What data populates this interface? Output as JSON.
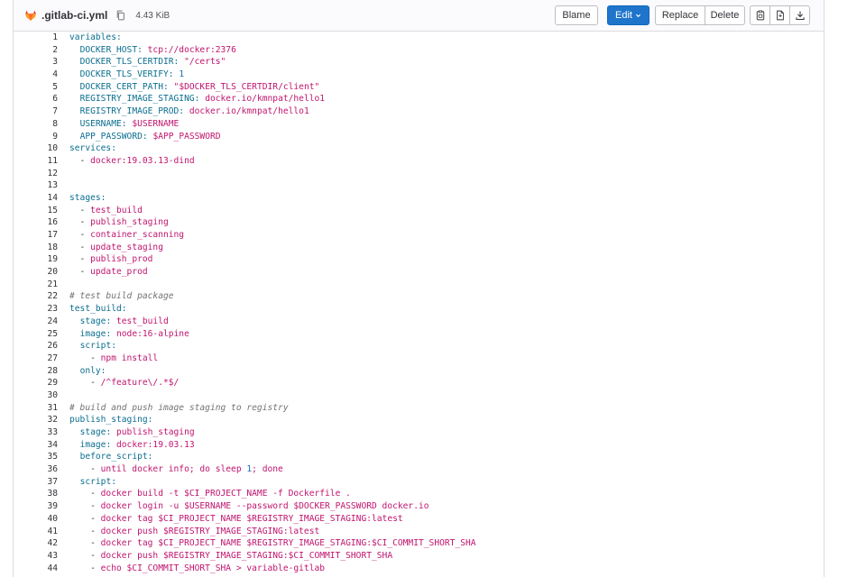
{
  "file": {
    "name": ".gitlab-ci.yml",
    "size": "4.43 KiB"
  },
  "toolbar": {
    "blame": "Blame",
    "edit": "Edit",
    "replace": "Replace",
    "delete": "Delete"
  },
  "icons": {
    "logo": "gitlab-logo-icon",
    "copy_path": "copy-icon",
    "copy_contents": "copy-contents-icon",
    "raw": "raw-file-icon",
    "download": "download-icon"
  },
  "colors": {
    "accent": "#1f75cb",
    "key": "#0b6e8f",
    "string": "#c0156e",
    "comment": "#737278"
  },
  "lines": [
    [
      [
        "k",
        "variables:"
      ]
    ],
    [
      [
        "p",
        "  "
      ],
      [
        "k",
        "DOCKER_HOST:"
      ],
      [
        "p",
        " "
      ],
      [
        "s",
        "tcp://docker:2376"
      ]
    ],
    [
      [
        "p",
        "  "
      ],
      [
        "k",
        "DOCKER_TLS_CERTDIR:"
      ],
      [
        "p",
        " "
      ],
      [
        "s",
        "\"/certs\""
      ]
    ],
    [
      [
        "p",
        "  "
      ],
      [
        "k",
        "DOCKER_TLS_VERIFY:"
      ],
      [
        "p",
        " "
      ],
      [
        "n",
        "1"
      ]
    ],
    [
      [
        "p",
        "  "
      ],
      [
        "k",
        "DOCKER_CERT_PATH:"
      ],
      [
        "p",
        " "
      ],
      [
        "s",
        "\"$DOCKER_TLS_CERTDIR/client\""
      ]
    ],
    [
      [
        "p",
        "  "
      ],
      [
        "k",
        "REGISTRY_IMAGE_STAGING:"
      ],
      [
        "p",
        " "
      ],
      [
        "s",
        "docker.io/kmnpat/hello1"
      ]
    ],
    [
      [
        "p",
        "  "
      ],
      [
        "k",
        "REGISTRY_IMAGE_PROD:"
      ],
      [
        "p",
        " "
      ],
      [
        "s",
        "docker.io/kmnpat/hello1"
      ]
    ],
    [
      [
        "p",
        "  "
      ],
      [
        "k",
        "USERNAME:"
      ],
      [
        "p",
        " "
      ],
      [
        "s",
        "$USERNAME"
      ]
    ],
    [
      [
        "p",
        "  "
      ],
      [
        "k",
        "APP_PASSWORD:"
      ],
      [
        "p",
        " "
      ],
      [
        "s",
        "$APP_PASSWORD"
      ]
    ],
    [
      [
        "k",
        "services:"
      ]
    ],
    [
      [
        "p",
        "  - "
      ],
      [
        "s",
        "docker:19.03.13-dind"
      ]
    ],
    [],
    [],
    [
      [
        "k",
        "stages:"
      ]
    ],
    [
      [
        "p",
        "  - "
      ],
      [
        "s",
        "test_build"
      ]
    ],
    [
      [
        "p",
        "  - "
      ],
      [
        "s",
        "publish_staging"
      ]
    ],
    [
      [
        "p",
        "  - "
      ],
      [
        "s",
        "container_scanning"
      ]
    ],
    [
      [
        "p",
        "  - "
      ],
      [
        "s",
        "update_staging"
      ]
    ],
    [
      [
        "p",
        "  - "
      ],
      [
        "s",
        "publish_prod"
      ]
    ],
    [
      [
        "p",
        "  - "
      ],
      [
        "s",
        "update_prod"
      ]
    ],
    [],
    [
      [
        "c",
        "# test build package"
      ]
    ],
    [
      [
        "k",
        "test_build:"
      ]
    ],
    [
      [
        "p",
        "  "
      ],
      [
        "k",
        "stage:"
      ],
      [
        "p",
        " "
      ],
      [
        "s",
        "test_build"
      ]
    ],
    [
      [
        "p",
        "  "
      ],
      [
        "k",
        "image:"
      ],
      [
        "p",
        " "
      ],
      [
        "s",
        "node:16-alpine"
      ]
    ],
    [
      [
        "p",
        "  "
      ],
      [
        "k",
        "script:"
      ]
    ],
    [
      [
        "p",
        "    - "
      ],
      [
        "s",
        "npm install"
      ]
    ],
    [
      [
        "p",
        "  "
      ],
      [
        "k",
        "only:"
      ]
    ],
    [
      [
        "p",
        "    - "
      ],
      [
        "s",
        "/^feature\\/.*$/"
      ]
    ],
    [],
    [
      [
        "c",
        "# build and push image staging to registry"
      ]
    ],
    [
      [
        "k",
        "publish_staging:"
      ]
    ],
    [
      [
        "p",
        "  "
      ],
      [
        "k",
        "stage:"
      ],
      [
        "p",
        " "
      ],
      [
        "s",
        "publish_staging"
      ]
    ],
    [
      [
        "p",
        "  "
      ],
      [
        "k",
        "image:"
      ],
      [
        "p",
        " "
      ],
      [
        "s",
        "docker:19.03.13"
      ]
    ],
    [
      [
        "p",
        "  "
      ],
      [
        "k",
        "before_script:"
      ]
    ],
    [
      [
        "p",
        "    - "
      ],
      [
        "s",
        "until docker info; do sleep "
      ],
      [
        "n",
        "1"
      ],
      [
        "s",
        "; done"
      ]
    ],
    [
      [
        "p",
        "  "
      ],
      [
        "k",
        "script:"
      ]
    ],
    [
      [
        "p",
        "    - "
      ],
      [
        "s",
        "docker build -t $CI_PROJECT_NAME -f Dockerfile ."
      ]
    ],
    [
      [
        "p",
        "    - "
      ],
      [
        "s",
        "docker login -u $USERNAME --password $DOCKER_PASSWORD docker.io"
      ]
    ],
    [
      [
        "p",
        "    - "
      ],
      [
        "s",
        "docker tag $CI_PROJECT_NAME $REGISTRY_IMAGE_STAGING:latest"
      ]
    ],
    [
      [
        "p",
        "    - "
      ],
      [
        "s",
        "docker push $REGISTRY_IMAGE_STAGING:latest"
      ]
    ],
    [
      [
        "p",
        "    - "
      ],
      [
        "s",
        "docker tag $CI_PROJECT_NAME $REGISTRY_IMAGE_STAGING:$CI_COMMIT_SHORT_SHA"
      ]
    ],
    [
      [
        "p",
        "    - "
      ],
      [
        "s",
        "docker push $REGISTRY_IMAGE_STAGING:$CI_COMMIT_SHORT_SHA"
      ]
    ],
    [
      [
        "p",
        "    - "
      ],
      [
        "s",
        "echo $CI_COMMIT_SHORT_SHA > variable-gitlab"
      ]
    ]
  ]
}
